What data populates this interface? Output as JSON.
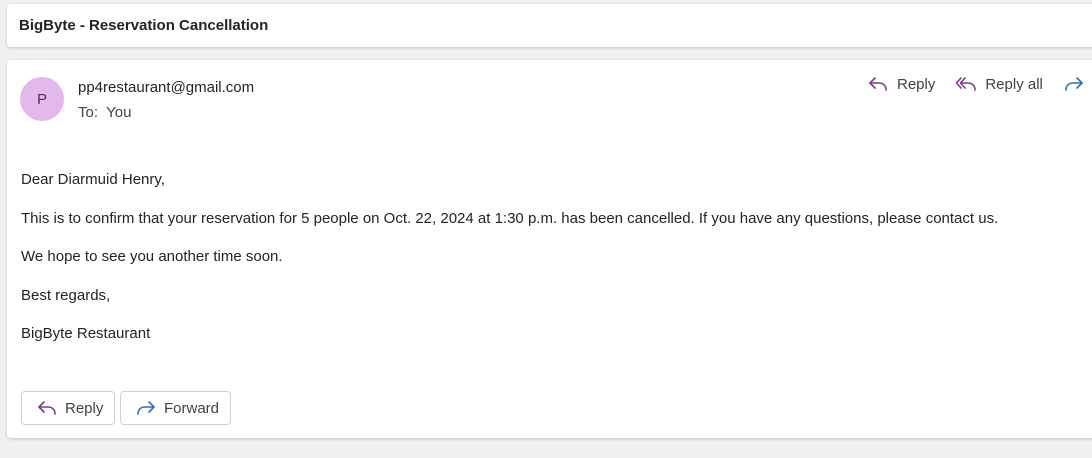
{
  "subject": "BigByte - Reservation Cancellation",
  "message": {
    "avatar_initial": "P",
    "sender": "pp4restaurant@gmail.com",
    "to_label": "To:",
    "to_value": "You",
    "actions": {
      "reply": "Reply",
      "reply_all": "Reply all"
    },
    "body": [
      "Dear Diarmuid Henry,",
      "This is to confirm that your reservation for 5 people on Oct. 22, 2024 at 1:30 p.m. has been cancelled. If you have any questions, please contact us.",
      "We hope to see you another time soon.",
      "Best regards,",
      "BigByte Restaurant"
    ],
    "bottom_buttons": {
      "reply": "Reply",
      "forward": "Forward"
    }
  },
  "colors": {
    "avatar_bg": "#e3b8ea",
    "reply_icon": "#7a3a86",
    "forward_icon": "#2f6fb5"
  },
  "icons": [
    "reply-icon",
    "reply-all-icon",
    "forward-icon"
  ]
}
